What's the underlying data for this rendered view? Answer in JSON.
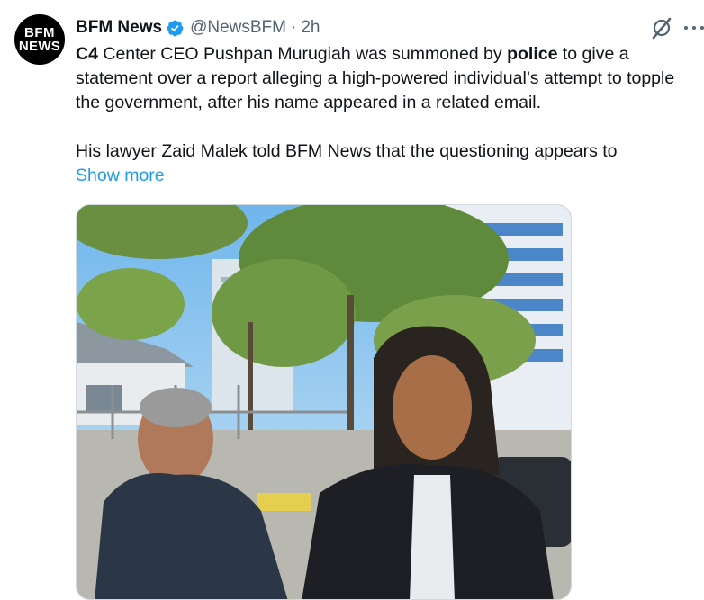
{
  "tweet": {
    "avatar": {
      "line1": "BFM",
      "line2": "NEWS"
    },
    "author_name": "BFM News",
    "handle": "@NewsBFM",
    "separator": "·",
    "time": "2h",
    "text": {
      "p1_bold1": "C4",
      "p1_part1": " Center CEO Pushpan Murugiah was summoned by ",
      "p1_bold2": "police",
      "p1_part2": " to give a statement over a report alleging a high-powered individual’s attempt to topple the government, after his name appeared in a related email.",
      "p2": "His lawyer Zaid Malek told BFM News that the questioning appears to",
      "show_more": "Show more"
    },
    "icons": {
      "verified": "verified-badge-icon",
      "grok": "grok-icon",
      "more": "more-options-icon"
    },
    "colors": {
      "link": "#1d9bf0",
      "verified": "#1d9bf0",
      "secondary": "#536471",
      "text": "#0f1419"
    },
    "media": {
      "type": "video-still",
      "description_icon": "photo"
    }
  }
}
